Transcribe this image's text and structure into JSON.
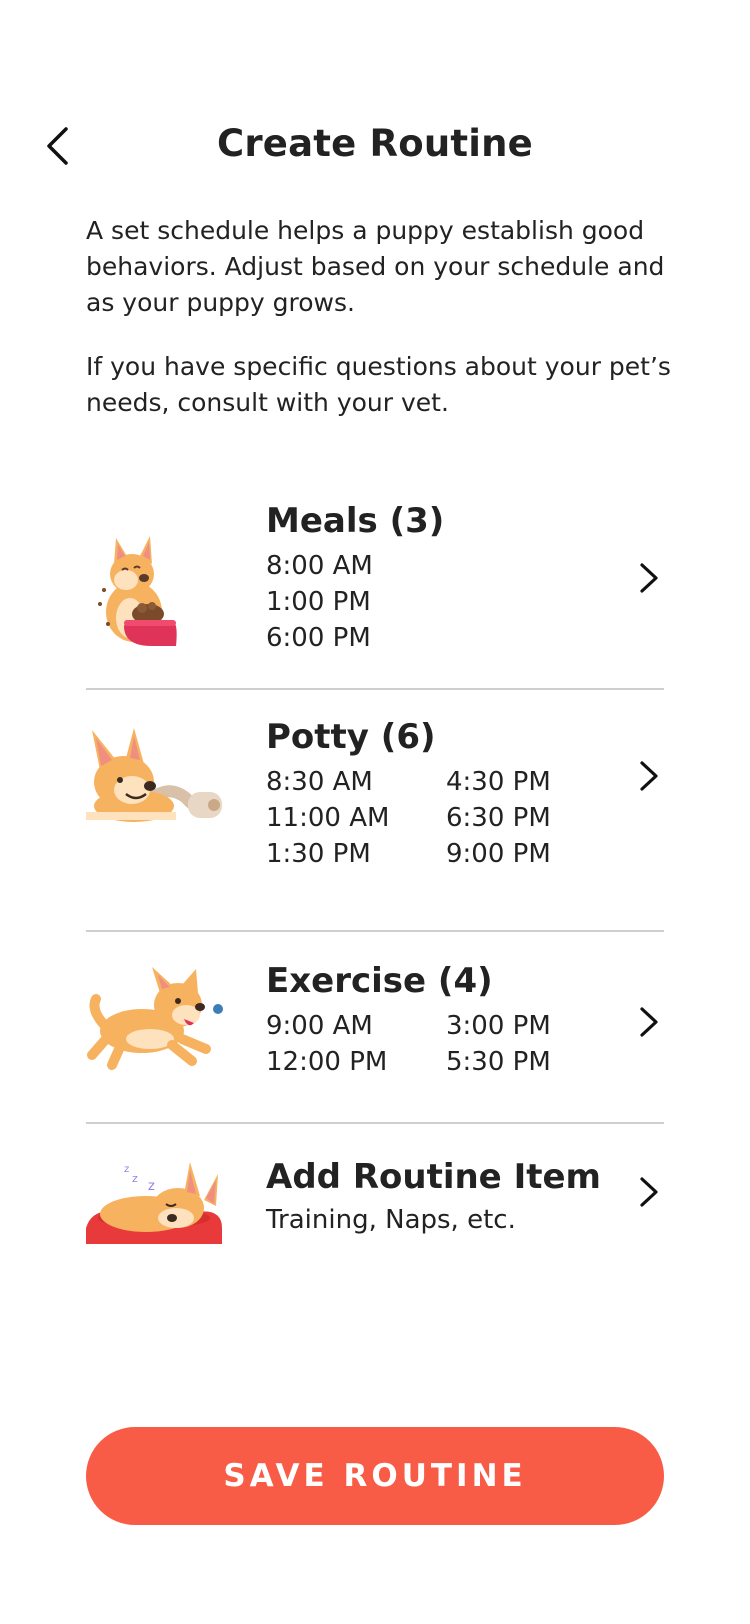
{
  "header": {
    "title": "Create Routine",
    "back_icon": "chevron-left-icon"
  },
  "intro": {
    "paragraph1": "A set schedule helps a puppy establish good behaviors. Adjust based on your schedule and as your puppy grows.",
    "paragraph2": "If you have specific questions about your pet’s needs, consult with your vet."
  },
  "routines": [
    {
      "title": "Meals (3)",
      "icon": "dog-eating-icon",
      "times": [
        "8:00 AM",
        "1:00 PM",
        "6:00 PM"
      ]
    },
    {
      "title": "Potty (6)",
      "icon": "dog-toilet-paper-icon",
      "times": [
        "8:30 AM",
        "4:30 PM",
        "11:00 AM",
        "6:30 PM",
        "1:30 PM",
        "9:00 PM"
      ]
    },
    {
      "title": "Exercise (4)",
      "icon": "dog-running-icon",
      "times": [
        "9:00 AM",
        "3:00 PM",
        "12:00 PM",
        "5:30 PM"
      ]
    },
    {
      "title": "Add Routine Item",
      "icon": "dog-sleeping-icon",
      "subtitle": "Training, Naps, etc."
    }
  ],
  "actions": {
    "save_label": "SAVE ROUTINE"
  },
  "colors": {
    "accent": "#f85c46",
    "divider": "#cfcfcf",
    "text": "#222222"
  }
}
